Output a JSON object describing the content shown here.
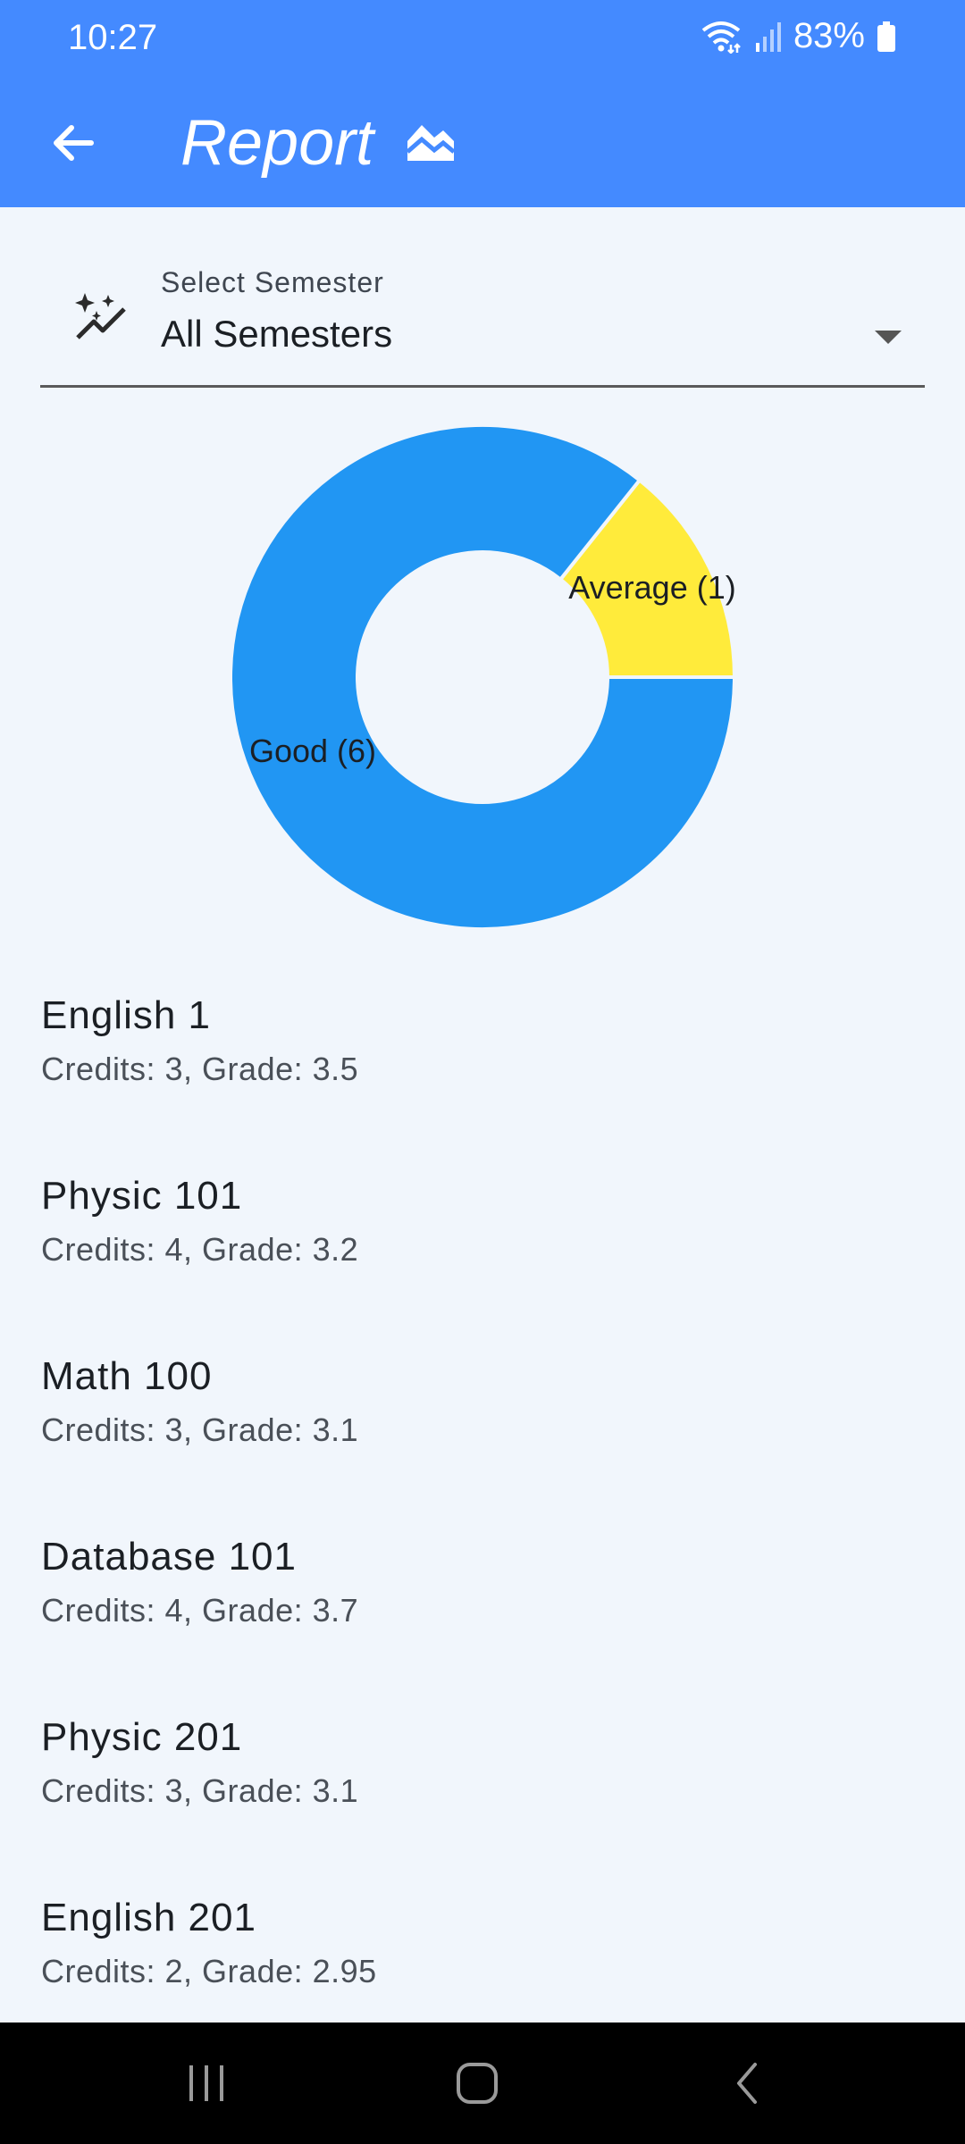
{
  "status_bar": {
    "time": "10:27",
    "battery": "83%",
    "icons": [
      "wifi-icon",
      "signal-icon",
      "battery-icon"
    ]
  },
  "app_bar": {
    "title": "Report",
    "icons": [
      "back-arrow-icon",
      "chart-landscape-icon"
    ]
  },
  "semester_select": {
    "label": "Select Semester",
    "value": "All Semesters",
    "icon": "sparkle-trend-icon"
  },
  "chart_data": {
    "type": "pie",
    "categories": [
      "Good (6)",
      "Average (1)"
    ],
    "values": [
      6,
      1
    ],
    "colors": [
      "#2196F3",
      "#FFEB3B"
    ],
    "donut": true
  },
  "courses": [
    {
      "name": "English 1",
      "details": "Credits: 3, Grade: 3.5"
    },
    {
      "name": "Physic 101",
      "details": "Credits: 4, Grade: 3.2"
    },
    {
      "name": "Math 100",
      "details": "Credits: 3, Grade: 3.1"
    },
    {
      "name": "Database 101",
      "details": "Credits: 4, Grade: 3.7"
    },
    {
      "name": "Physic 201",
      "details": "Credits: 3, Grade: 3.1"
    },
    {
      "name": "English 201",
      "details": "Credits: 2, Grade: 2.95"
    }
  ],
  "nav_bar": {
    "icons": [
      "recent-apps-icon",
      "home-icon",
      "back-icon"
    ]
  }
}
